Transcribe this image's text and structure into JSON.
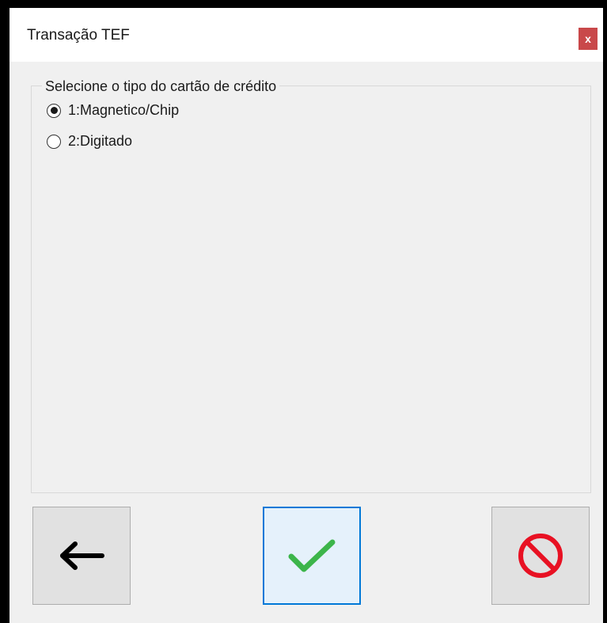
{
  "window": {
    "title": "Transação TEF",
    "close_label": "x"
  },
  "group": {
    "legend": "Selecione o tipo do cartão de crédito",
    "options": [
      {
        "label": "1:Magnetico/Chip",
        "selected": true
      },
      {
        "label": "2:Digitado",
        "selected": false
      }
    ]
  },
  "buttons": {
    "back_icon": "arrow-left-icon",
    "confirm_icon": "check-icon",
    "cancel_icon": "prohibited-icon"
  },
  "colors": {
    "close_bg": "#c9484a",
    "confirm_check": "#3cb54a",
    "cancel_red": "#e81123",
    "focus_border": "#0078d7"
  }
}
